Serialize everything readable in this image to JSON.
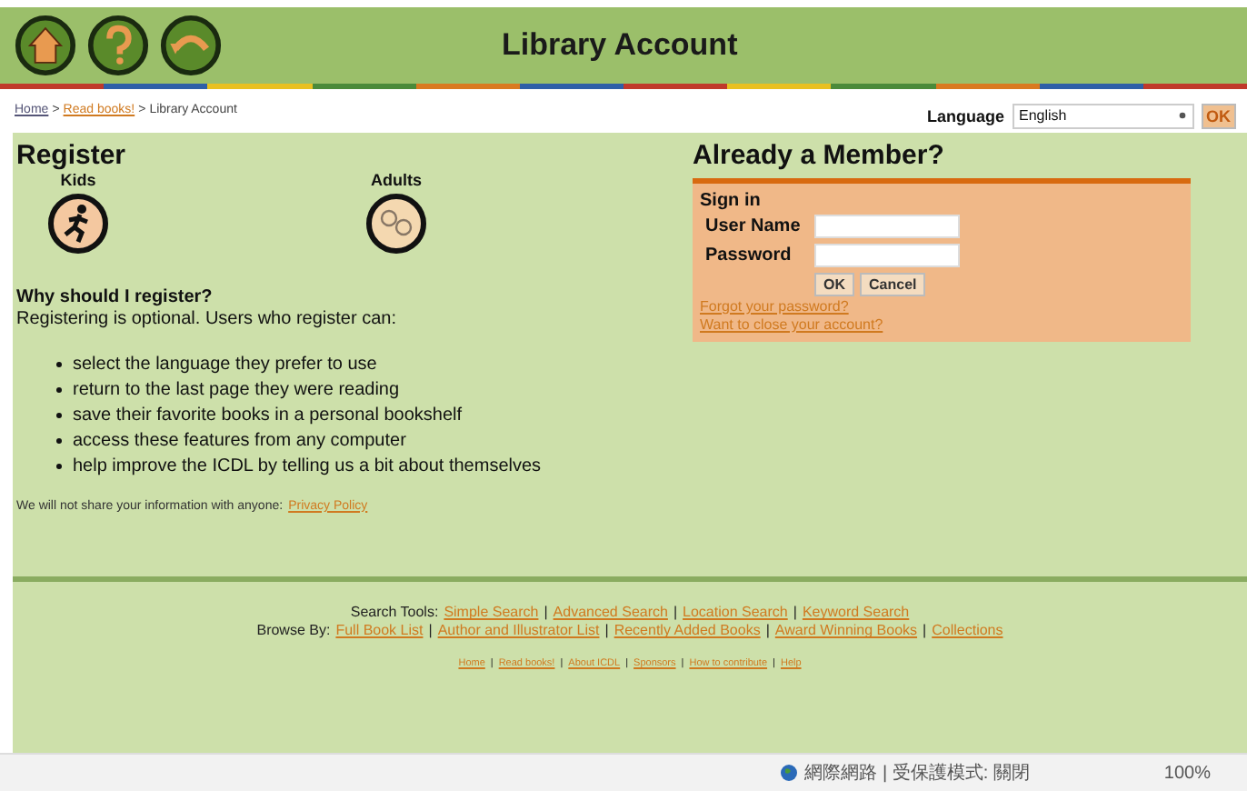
{
  "header": {
    "title": "Library Account"
  },
  "breadcrumb_separator": ">",
  "footer_separator": "|",
  "breadcrumb": [
    {
      "label": "Home",
      "link": true
    },
    {
      "label": "Read books!",
      "link": true
    },
    {
      "label": "Library Account",
      "link": false
    }
  ],
  "language": {
    "label": "Language",
    "value": "English",
    "button": "OK"
  },
  "register": {
    "title": "Register",
    "options": [
      {
        "label": "Kids",
        "kind": "kids"
      },
      {
        "label": "Adults",
        "kind": "adults"
      }
    ],
    "why_title": "Why should I register?",
    "intro": "Registering is optional. Users who register can:",
    "benefits": [
      "select the language they prefer to use",
      "return to the last page they were reading",
      "save their favorite books in a personal bookshelf",
      "access these features from any computer",
      "help improve the ICDL by telling us a bit about themselves"
    ],
    "privacy_text": "We will not share your information with anyone:",
    "privacy_link": "Privacy Policy"
  },
  "member": {
    "title": "Already a Member?",
    "sign_in": "Sign in",
    "fields": [
      {
        "label": "User Name"
      },
      {
        "label": "Password"
      }
    ],
    "buttons": [
      "OK",
      "Cancel"
    ],
    "links": [
      "Forgot your password?",
      "Want to close your account?"
    ]
  },
  "footer": {
    "search_label": "Search Tools:",
    "search_links": [
      "Simple Search",
      "Advanced Search",
      "Location Search",
      "Keyword Search"
    ],
    "browse_label": "Browse By:",
    "browse_links": [
      "Full Book List",
      "Author and Illustrator List",
      "Recently Added Books",
      "Award Winning Books",
      "Collections"
    ],
    "bottom_links": [
      "Home",
      "Read books!",
      "About ICDL",
      "Sponsors",
      "How to contribute",
      "Help"
    ]
  },
  "status_bar": {
    "zone": "網際網路 | 受保護模式: 關閉",
    "zoom": "100%"
  }
}
